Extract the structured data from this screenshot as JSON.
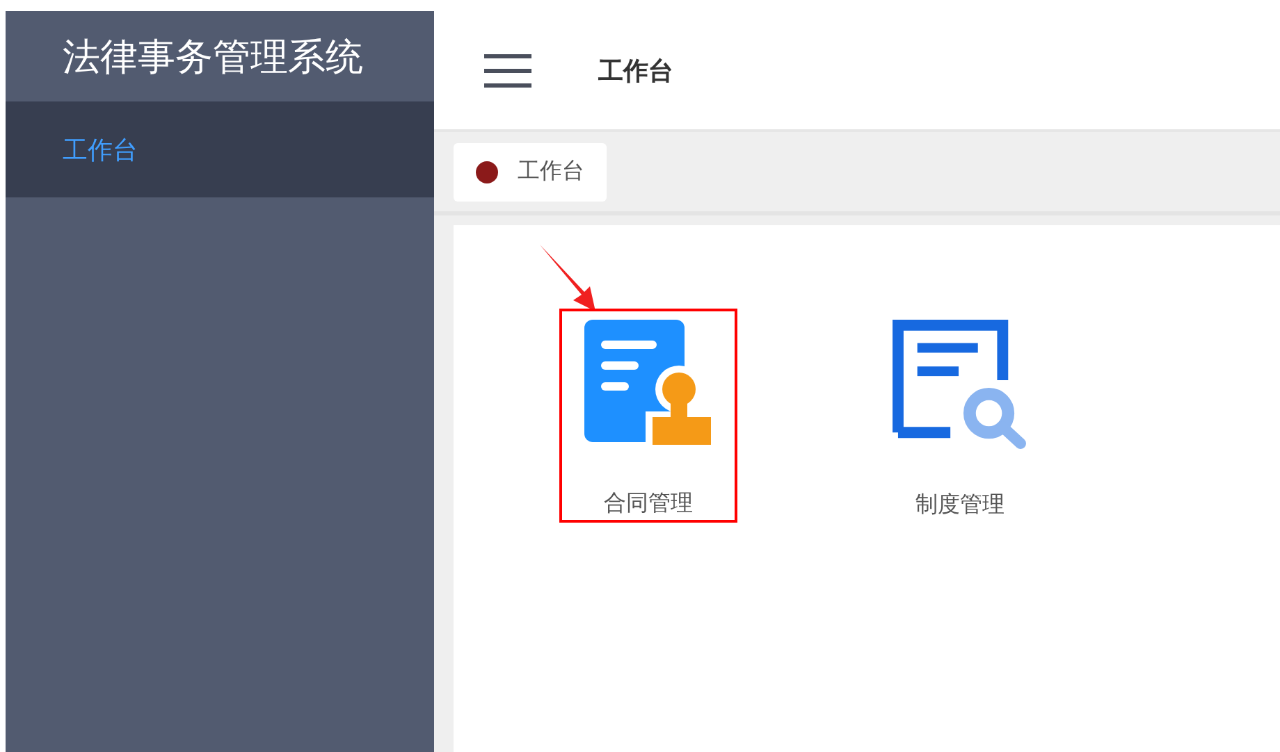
{
  "sidebar": {
    "title": "法律事务管理系统",
    "items": [
      {
        "label": "工作台",
        "selected": true
      }
    ]
  },
  "header": {
    "title": "工作台"
  },
  "tags": [
    {
      "label": "工作台",
      "selected": true
    }
  ],
  "apps": [
    {
      "label": "合同管理",
      "kind": "contract",
      "highlighted": true
    },
    {
      "label": "制度管理",
      "kind": "policy",
      "highlighted": false
    }
  ]
}
